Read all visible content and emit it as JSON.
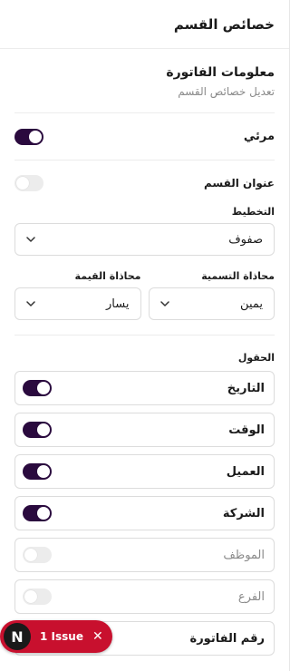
{
  "header": {
    "title": "خصائص القسم"
  },
  "section_info": {
    "title": "معلومات الفاتورة",
    "subtitle": "تعديل خصائص القسم"
  },
  "visible": {
    "label": "مرئي",
    "on": true
  },
  "section_title": {
    "label": "عنوان القسم",
    "on": false
  },
  "layout": {
    "label": "التخطيط",
    "value": "صفوف"
  },
  "label_align": {
    "label": "محاذاة التسمية",
    "value": "يمين"
  },
  "value_align": {
    "label": "محاذاة القيمة",
    "value": "يسار"
  },
  "fields": {
    "title": "الحقول",
    "items": [
      {
        "name": "التاريخ",
        "on": true
      },
      {
        "name": "الوقت",
        "on": true
      },
      {
        "name": "العميل",
        "on": true
      },
      {
        "name": "الشركة",
        "on": true
      },
      {
        "name": "الموظف",
        "on": false
      },
      {
        "name": "الفرع",
        "on": false
      },
      {
        "name": "رقم الفاتورة",
        "on": true
      }
    ]
  },
  "issue_badge": {
    "avatar_letter": "N",
    "text": "1 Issue",
    "color": "#c8102e"
  },
  "colors": {
    "accent": "#2a0a3e",
    "toggle_off": "#ececec",
    "border": "#dcdcdc"
  }
}
